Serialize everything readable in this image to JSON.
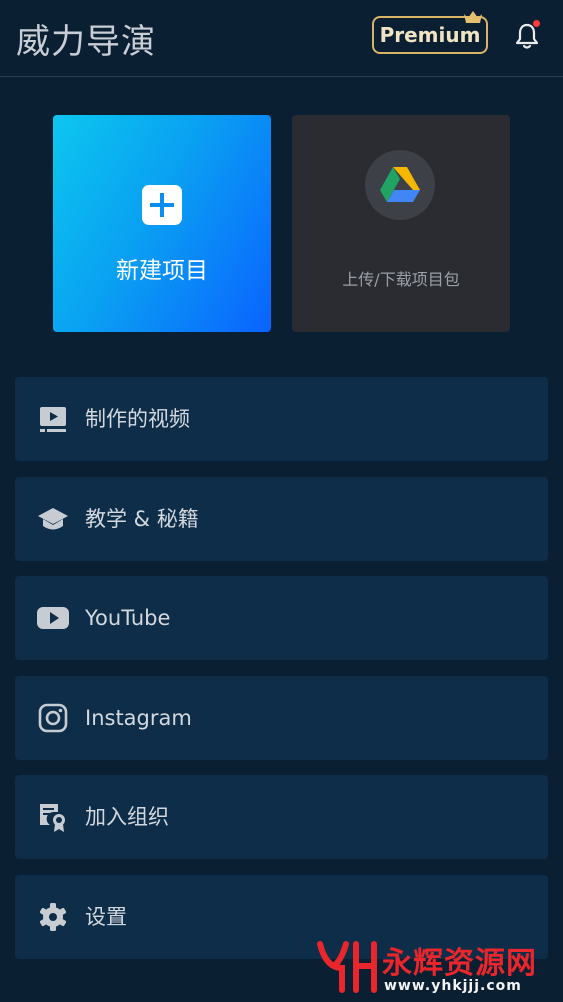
{
  "header": {
    "title": "威力导演",
    "premium_label": "Premium",
    "notification_badge": true
  },
  "cards": {
    "new_project": {
      "label": "新建项目",
      "icon": "plus-icon"
    },
    "drive": {
      "label": "上传/下载项目包",
      "icon": "google-drive-icon"
    }
  },
  "menu": {
    "items": [
      {
        "label": "制作的视频",
        "icon": "video-icon"
      },
      {
        "label": "教学 & 秘籍",
        "icon": "graduation-cap-icon"
      },
      {
        "label": "YouTube",
        "icon": "youtube-icon"
      },
      {
        "label": "Instagram",
        "icon": "instagram-icon"
      },
      {
        "label": "加入组织",
        "icon": "certificate-icon"
      },
      {
        "label": "设置",
        "icon": "gear-icon"
      }
    ]
  },
  "watermark": {
    "title": "永辉资源网",
    "url": "www.yhkjjj.com"
  },
  "colors": {
    "background": "#0b1f33",
    "menu_item": "#0d2d48",
    "premium_border": "#d9b466",
    "drive_card": "#2b2c31",
    "watermark_red": "#e8262b"
  }
}
